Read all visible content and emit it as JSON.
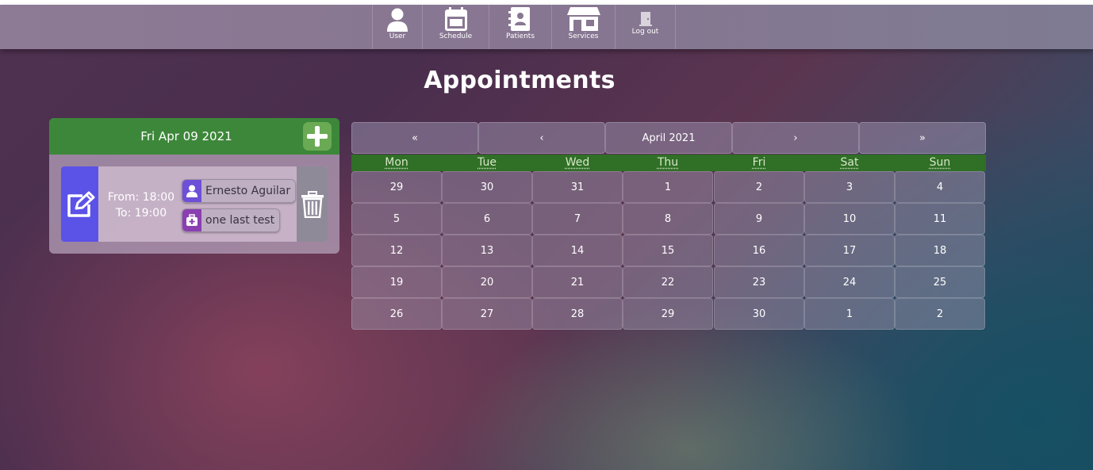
{
  "nav": {
    "items": [
      {
        "label": "User",
        "icon": "user-icon"
      },
      {
        "label": "Schedule",
        "icon": "calendar-icon"
      },
      {
        "label": "Patients",
        "icon": "address-book-icon"
      },
      {
        "label": "Services",
        "icon": "store-icon"
      },
      {
        "label": "Log out",
        "icon": "door-icon"
      }
    ]
  },
  "page": {
    "title": "Appointments"
  },
  "day_panel": {
    "date": "Fri Apr 09 2021",
    "appointment": {
      "from": "From: 18:00",
      "to": "To: 19:00",
      "patient": "Ernesto Aguilar",
      "service": "one last test"
    }
  },
  "calendar": {
    "prev_year": "«",
    "prev_month": "‹",
    "month_label": "April 2021",
    "next_month": "›",
    "next_year": "»",
    "weekdays": [
      "Mon",
      "Tue",
      "Wed",
      "Thu",
      "Fri",
      "Sat",
      "Sun"
    ],
    "weeks": [
      [
        "29",
        "30",
        "31",
        "1",
        "2",
        "3",
        "4"
      ],
      [
        "5",
        "6",
        "7",
        "8",
        "9",
        "10",
        "11"
      ],
      [
        "12",
        "13",
        "14",
        "15",
        "16",
        "17",
        "18"
      ],
      [
        "19",
        "20",
        "21",
        "22",
        "23",
        "24",
        "25"
      ],
      [
        "26",
        "27",
        "28",
        "29",
        "30",
        "1",
        "2"
      ]
    ]
  },
  "colors": {
    "header_green": "#3d873a",
    "weekday_green": "#2f6f26",
    "edit_blue": "#5b52e8",
    "chip_purple": "#6d4fd8"
  }
}
